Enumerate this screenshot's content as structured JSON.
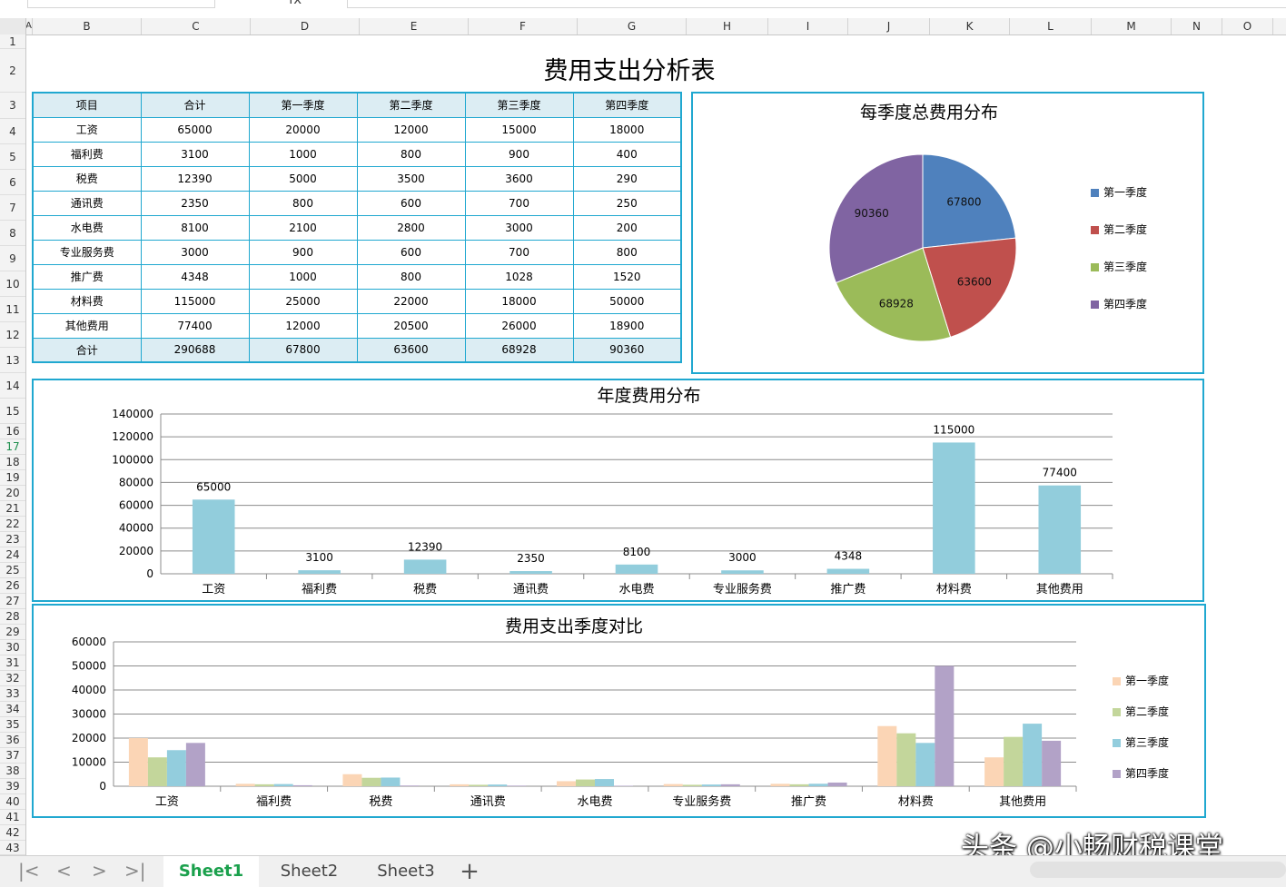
{
  "formula_bar": {
    "fx_glyph": "fx"
  },
  "columns": [
    "A",
    "B",
    "C",
    "D",
    "E",
    "F",
    "G",
    "H",
    "I",
    "J",
    "K",
    "L",
    "M",
    "N",
    "O"
  ],
  "rows": [
    "1",
    "2",
    "3",
    "4",
    "5",
    "6",
    "7",
    "8",
    "9",
    "10",
    "11",
    "12",
    "13",
    "14",
    "15",
    "16",
    "17",
    "18",
    "19",
    "20",
    "21",
    "22",
    "23",
    "24",
    "25",
    "26",
    "27",
    "28",
    "29",
    "30",
    "31",
    "32",
    "33",
    "34",
    "35",
    "36",
    "37",
    "38",
    "39",
    "40",
    "41",
    "42",
    "43"
  ],
  "active_row": "17",
  "sheet_title": "费用支出分析表",
  "table": {
    "headers": [
      "项目",
      "合计",
      "第一季度",
      "第二季度",
      "第三季度",
      "第四季度"
    ],
    "rows": [
      [
        "工资",
        "65000",
        "20000",
        "12000",
        "15000",
        "18000"
      ],
      [
        "福利费",
        "3100",
        "1000",
        "800",
        "900",
        "400"
      ],
      [
        "税费",
        "12390",
        "5000",
        "3500",
        "3600",
        "290"
      ],
      [
        "通讯费",
        "2350",
        "800",
        "600",
        "700",
        "250"
      ],
      [
        "水电费",
        "8100",
        "2100",
        "2800",
        "3000",
        "200"
      ],
      [
        "专业服务费",
        "3000",
        "900",
        "600",
        "700",
        "800"
      ],
      [
        "推广费",
        "4348",
        "1000",
        "800",
        "1028",
        "1520"
      ],
      [
        "材料费",
        "115000",
        "25000",
        "22000",
        "18000",
        "50000"
      ],
      [
        "其他费用",
        "77400",
        "12000",
        "20500",
        "26000",
        "18900"
      ]
    ],
    "total": [
      "合计",
      "290688",
      "67800",
      "63600",
      "68928",
      "90360"
    ]
  },
  "colors": {
    "border": "#20a8d0",
    "header_bg": "#dcedf3",
    "q1": "#4f81bd",
    "q2": "#c0504d",
    "q3": "#9bbb59",
    "q4": "#8064a2",
    "bar": "#92cddc",
    "cmp_q1": "#fbd5b5",
    "cmp_q2": "#c3d69b",
    "cmp_q3": "#93cddd",
    "cmp_q4": "#b2a2c7",
    "active_tab": "#1aa04c"
  },
  "chart_data": [
    {
      "type": "pie",
      "title": "每季度总费用分布",
      "categories": [
        "第一季度",
        "第二季度",
        "第三季度",
        "第四季度"
      ],
      "values": [
        67800,
        63600,
        68928,
        90360
      ],
      "legend": "right"
    },
    {
      "type": "bar",
      "title": "年度费用分布",
      "categories": [
        "工资",
        "福利费",
        "税费",
        "通讯费",
        "水电费",
        "专业服务费",
        "推广费",
        "材料费",
        "其他费用"
      ],
      "values": [
        65000,
        3100,
        12390,
        2350,
        8100,
        3000,
        4348,
        115000,
        77400
      ],
      "ylim": [
        0,
        140000
      ],
      "yticks": [
        "0",
        "20000",
        "40000",
        "60000",
        "80000",
        "100000",
        "120000",
        "140000"
      ],
      "grid": true
    },
    {
      "type": "bar",
      "title": "费用支出季度对比",
      "categories": [
        "工资",
        "福利费",
        "税费",
        "通讯费",
        "水电费",
        "专业服务费",
        "推广费",
        "材料费",
        "其他费用"
      ],
      "series": [
        {
          "name": "第一季度",
          "values": [
            20000,
            1000,
            5000,
            800,
            2100,
            900,
            1000,
            25000,
            12000
          ]
        },
        {
          "name": "第二季度",
          "values": [
            12000,
            800,
            3500,
            600,
            2800,
            600,
            800,
            22000,
            20500
          ]
        },
        {
          "name": "第三季度",
          "values": [
            15000,
            900,
            3600,
            700,
            3000,
            700,
            1028,
            18000,
            26000
          ]
        },
        {
          "name": "第四季度",
          "values": [
            18000,
            400,
            290,
            250,
            200,
            800,
            1520,
            50000,
            18900
          ]
        }
      ],
      "ylim": [
        0,
        60000
      ],
      "yticks": [
        "0",
        "10000",
        "20000",
        "30000",
        "40000",
        "50000",
        "60000"
      ],
      "grid": true,
      "legend": "right"
    }
  ],
  "tabs": [
    "Sheet1",
    "Sheet2",
    "Sheet3"
  ],
  "add_tab": "+",
  "nav": {
    "first": "|<",
    "prev": "<",
    "next": ">",
    "last": ">|"
  },
  "watermark": "头条 @小畅财税课堂"
}
